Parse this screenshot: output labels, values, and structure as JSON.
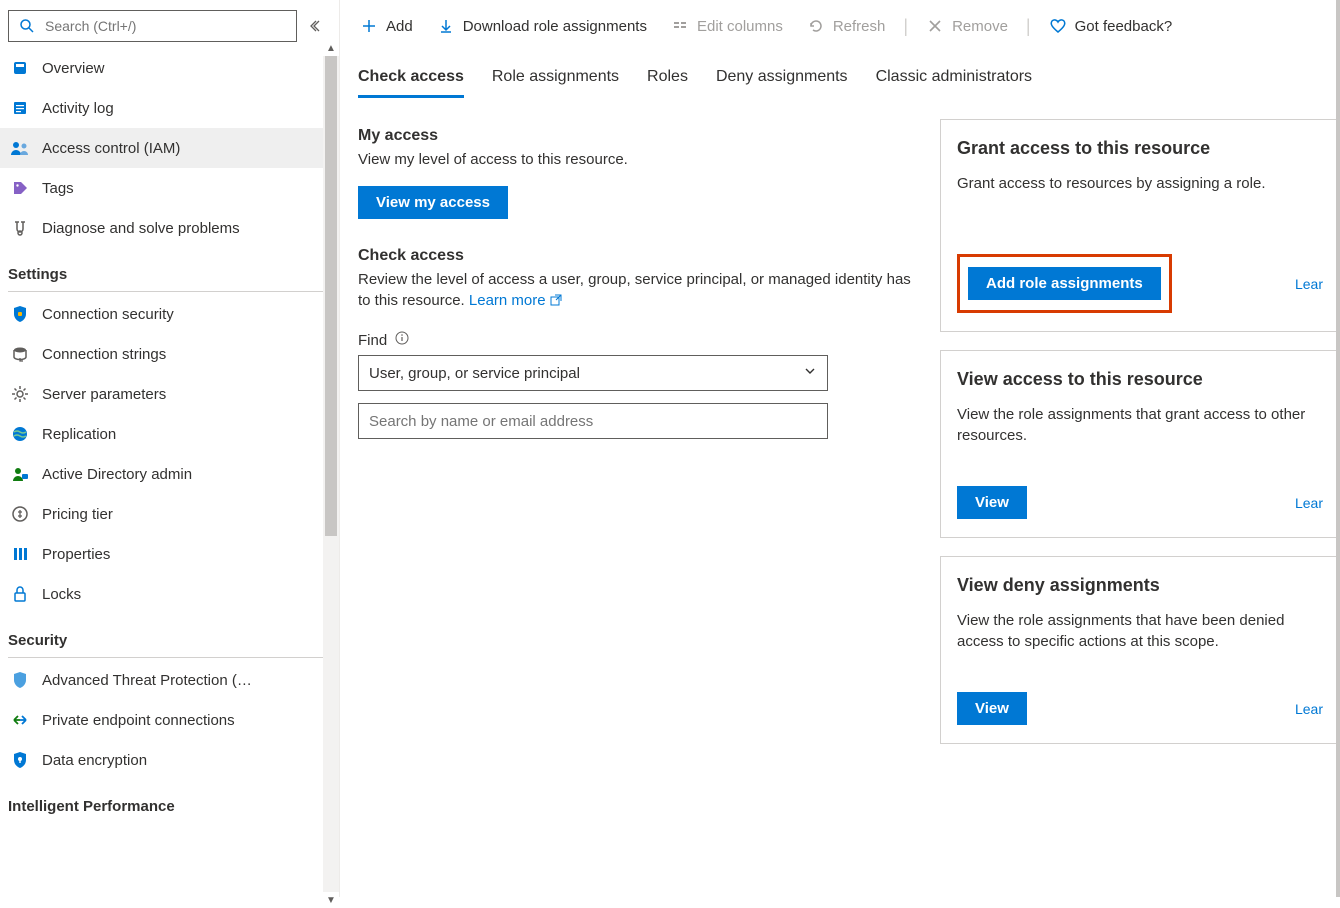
{
  "search": {
    "placeholder": "Search (Ctrl+/)"
  },
  "sidebar": {
    "top": [
      {
        "label": "Overview",
        "icon": "overview"
      },
      {
        "label": "Activity log",
        "icon": "activity"
      },
      {
        "label": "Access control (IAM)",
        "icon": "iam",
        "active": true
      },
      {
        "label": "Tags",
        "icon": "tags"
      },
      {
        "label": "Diagnose and solve problems",
        "icon": "diagnose"
      }
    ],
    "sections": [
      {
        "title": "Settings",
        "items": [
          {
            "label": "Connection security",
            "icon": "shield"
          },
          {
            "label": "Connection strings",
            "icon": "conn"
          },
          {
            "label": "Server parameters",
            "icon": "gear"
          },
          {
            "label": "Replication",
            "icon": "globe"
          },
          {
            "label": "Active Directory admin",
            "icon": "admin"
          },
          {
            "label": "Pricing tier",
            "icon": "pricing"
          },
          {
            "label": "Properties",
            "icon": "properties"
          },
          {
            "label": "Locks",
            "icon": "lock"
          }
        ]
      },
      {
        "title": "Security",
        "items": [
          {
            "label": "Advanced Threat Protection (…",
            "icon": "shield2"
          },
          {
            "label": "Private endpoint connections",
            "icon": "endpoint"
          },
          {
            "label": "Data encryption",
            "icon": "encrypt"
          }
        ]
      },
      {
        "title": "Intelligent Performance",
        "items": []
      }
    ]
  },
  "toolbar": {
    "add": "Add",
    "download": "Download role assignments",
    "edit_columns": "Edit columns",
    "refresh": "Refresh",
    "remove": "Remove",
    "feedback": "Got feedback?"
  },
  "tabs": [
    {
      "id": "check",
      "label": "Check access",
      "active": true
    },
    {
      "id": "role",
      "label": "Role assignments"
    },
    {
      "id": "roles",
      "label": "Roles"
    },
    {
      "id": "deny",
      "label": "Deny assignments"
    },
    {
      "id": "classic",
      "label": "Classic administrators"
    }
  ],
  "main": {
    "myaccess_title": "My access",
    "myaccess_desc": "View my level of access to this resource.",
    "view_my_access_btn": "View my access",
    "check_title": "Check access",
    "check_desc": "Review the level of access a user, group, service principal, or managed identity has to this resource. ",
    "learn_more": "Learn more",
    "find_label": "Find",
    "find_select": "User, group, or service principal",
    "find_placeholder": "Search by name or email address"
  },
  "cards": {
    "grant": {
      "title": "Grant access to this resource",
      "desc": "Grant access to resources by assigning a role.",
      "btn": "Add role assignments",
      "link": "Lear"
    },
    "view": {
      "title": "View access to this resource",
      "desc": "View the role assignments that grant access to other resources.",
      "btn": "View",
      "link": "Lear"
    },
    "deny": {
      "title": "View deny assignments",
      "desc": "View the role assignments that have been denied access to specific actions at this scope.",
      "btn": "View",
      "link": "Lear"
    }
  }
}
